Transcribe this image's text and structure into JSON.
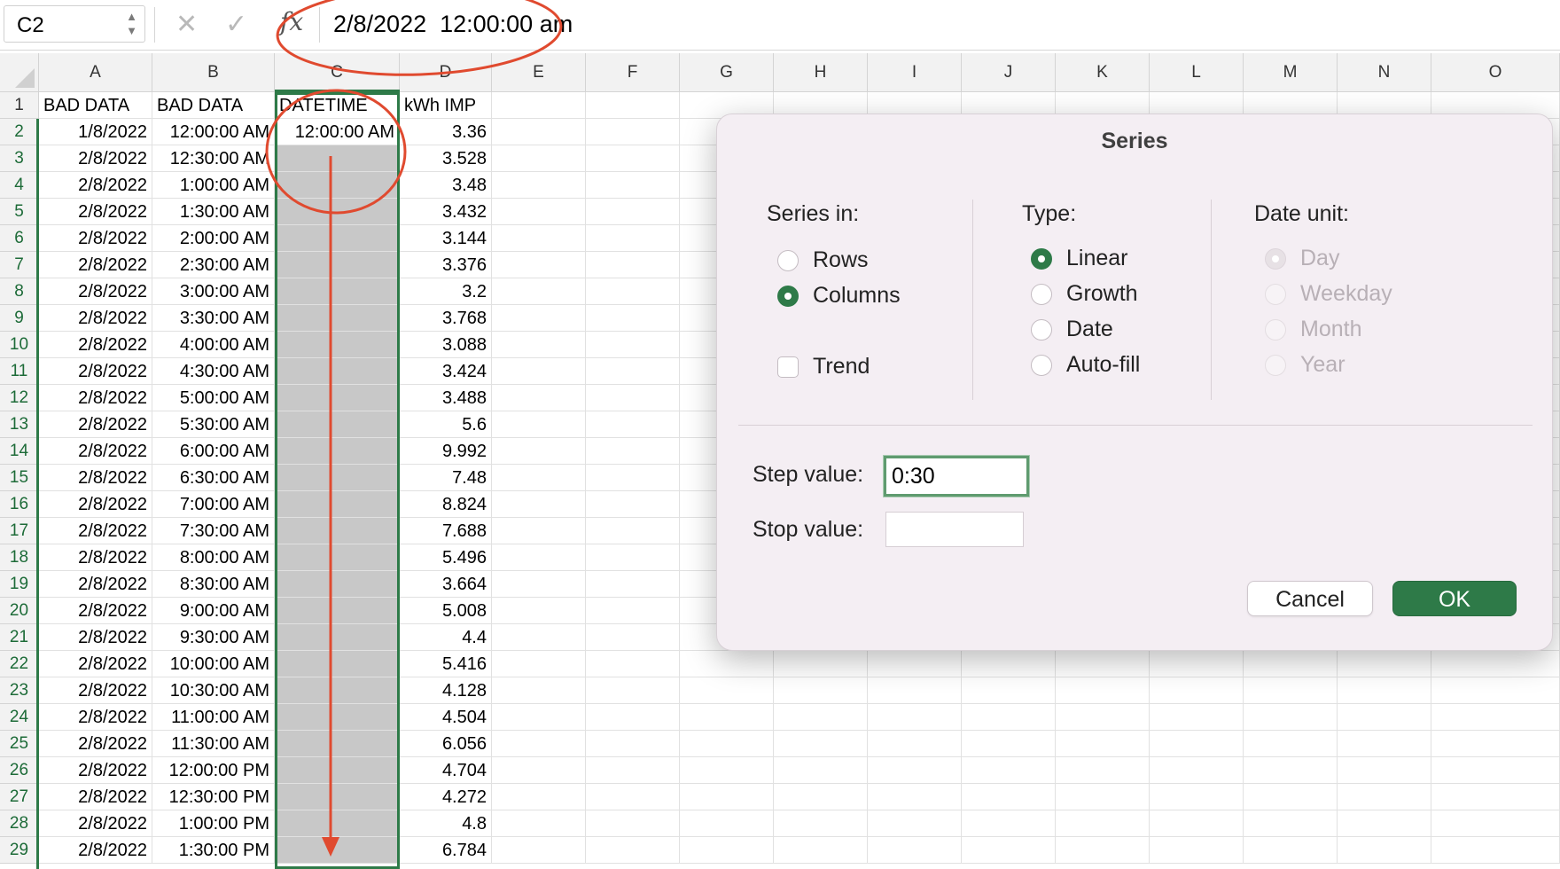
{
  "formula_bar": {
    "name_box": "C2",
    "cancel_icon": "close-icon",
    "enter_icon": "check-icon",
    "function_label": "fx",
    "formula": "2/8/2022  12:00:00 am"
  },
  "columns": [
    "A",
    "B",
    "C",
    "D",
    "E",
    "F",
    "G",
    "H",
    "I",
    "J",
    "K",
    "L",
    "M",
    "N",
    "O"
  ],
  "row_numbers": [
    "1",
    "2",
    "3",
    "4",
    "5",
    "6",
    "7",
    "8",
    "9",
    "10",
    "11",
    "12",
    "13",
    "14",
    "15",
    "16",
    "17",
    "18",
    "19",
    "20",
    "21",
    "22",
    "23",
    "24",
    "25",
    "26",
    "27",
    "28",
    "29"
  ],
  "header_row": [
    "BAD DATA",
    "BAD DATA",
    "DATETIME",
    "kWh IMP"
  ],
  "rows": [
    [
      "1/8/2022",
      "12:00:00 AM",
      "12:00:00 AM",
      "3.36"
    ],
    [
      "2/8/2022",
      "12:30:00 AM",
      "",
      "3.528"
    ],
    [
      "2/8/2022",
      "1:00:00 AM",
      "",
      "3.48"
    ],
    [
      "2/8/2022",
      "1:30:00 AM",
      "",
      "3.432"
    ],
    [
      "2/8/2022",
      "2:00:00 AM",
      "",
      "3.144"
    ],
    [
      "2/8/2022",
      "2:30:00 AM",
      "",
      "3.376"
    ],
    [
      "2/8/2022",
      "3:00:00 AM",
      "",
      "3.2"
    ],
    [
      "2/8/2022",
      "3:30:00 AM",
      "",
      "3.768"
    ],
    [
      "2/8/2022",
      "4:00:00 AM",
      "",
      "3.088"
    ],
    [
      "2/8/2022",
      "4:30:00 AM",
      "",
      "3.424"
    ],
    [
      "2/8/2022",
      "5:00:00 AM",
      "",
      "3.488"
    ],
    [
      "2/8/2022",
      "5:30:00 AM",
      "",
      "5.6"
    ],
    [
      "2/8/2022",
      "6:00:00 AM",
      "",
      "9.992"
    ],
    [
      "2/8/2022",
      "6:30:00 AM",
      "",
      "7.48"
    ],
    [
      "2/8/2022",
      "7:00:00 AM",
      "",
      "8.824"
    ],
    [
      "2/8/2022",
      "7:30:00 AM",
      "",
      "7.688"
    ],
    [
      "2/8/2022",
      "8:00:00 AM",
      "",
      "5.496"
    ],
    [
      "2/8/2022",
      "8:30:00 AM",
      "",
      "3.664"
    ],
    [
      "2/8/2022",
      "9:00:00 AM",
      "",
      "5.008"
    ],
    [
      "2/8/2022",
      "9:30:00 AM",
      "",
      "4.4"
    ],
    [
      "2/8/2022",
      "10:00:00 AM",
      "",
      "5.416"
    ],
    [
      "2/8/2022",
      "10:30:00 AM",
      "",
      "4.128"
    ],
    [
      "2/8/2022",
      "11:00:00 AM",
      "",
      "4.504"
    ],
    [
      "2/8/2022",
      "11:30:00 AM",
      "",
      "6.056"
    ],
    [
      "2/8/2022",
      "12:00:00 PM",
      "",
      "4.704"
    ],
    [
      "2/8/2022",
      "12:30:00 PM",
      "",
      "4.272"
    ],
    [
      "2/8/2022",
      "1:00:00 PM",
      "",
      "4.8"
    ],
    [
      "2/8/2022",
      "1:30:00 PM",
      "",
      "6.784"
    ]
  ],
  "dialog": {
    "title": "Series",
    "series_in": {
      "label": "Series in:",
      "rows": "Rows",
      "columns": "Columns",
      "selected": "Columns"
    },
    "trend": {
      "label": "Trend",
      "checked": false
    },
    "type": {
      "label": "Type:",
      "options": [
        "Linear",
        "Growth",
        "Date",
        "Auto-fill"
      ],
      "selected": "Linear"
    },
    "date_unit": {
      "label": "Date unit:",
      "options": [
        "Day",
        "Weekday",
        "Month",
        "Year"
      ],
      "selected": "Day",
      "enabled": false
    },
    "step_value": {
      "label": "Step value:",
      "value": "0:30"
    },
    "stop_value": {
      "label": "Stop value:",
      "value": ""
    },
    "cancel_label": "Cancel",
    "ok_label": "OK"
  },
  "colors": {
    "accent_green": "#2e7a48",
    "annotation_red": "#e04a2f",
    "selection_fill": "#c8c8c8"
  }
}
